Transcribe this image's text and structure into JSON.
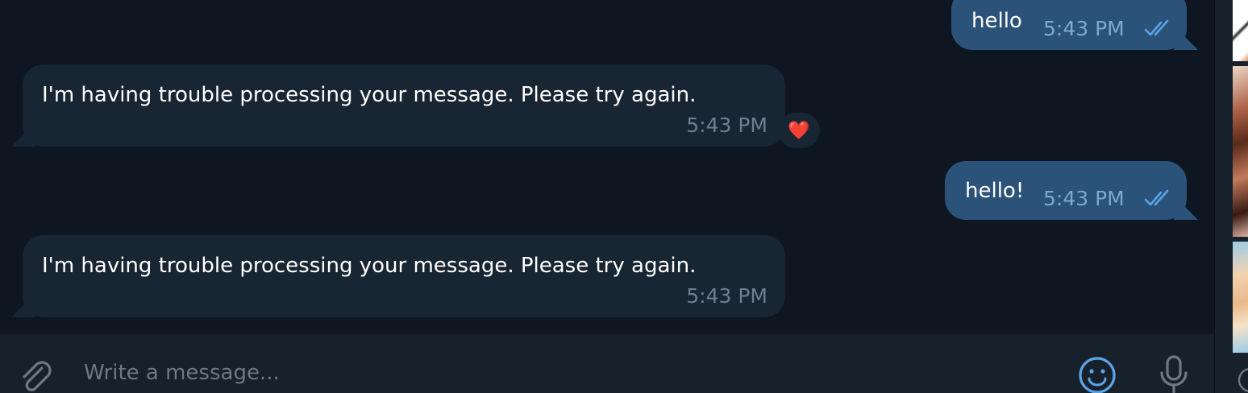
{
  "messages": [
    {
      "direction": "outgoing",
      "text": "hello",
      "time": "5:43 PM",
      "status": "read"
    },
    {
      "direction": "incoming",
      "text": "I'm having trouble processing your message. Please try again.",
      "time": "5:43 PM",
      "reaction": "❤️"
    },
    {
      "direction": "outgoing",
      "text": "hello!",
      "time": "5:43 PM",
      "status": "read"
    },
    {
      "direction": "incoming",
      "text": "I'm having trouble processing your message. Please try again.",
      "time": "5:43 PM"
    }
  ],
  "composer": {
    "placeholder": "Write a message...",
    "value": "",
    "attach_icon": "paperclip-icon",
    "emoji_icon": "smiley-icon",
    "voice_icon": "microphone-icon"
  },
  "colors": {
    "background": "#0e1621",
    "incoming_bubble": "#182533",
    "outgoing_bubble": "#2b5278",
    "composer": "#17212b",
    "accent": "#5aa4e8"
  }
}
